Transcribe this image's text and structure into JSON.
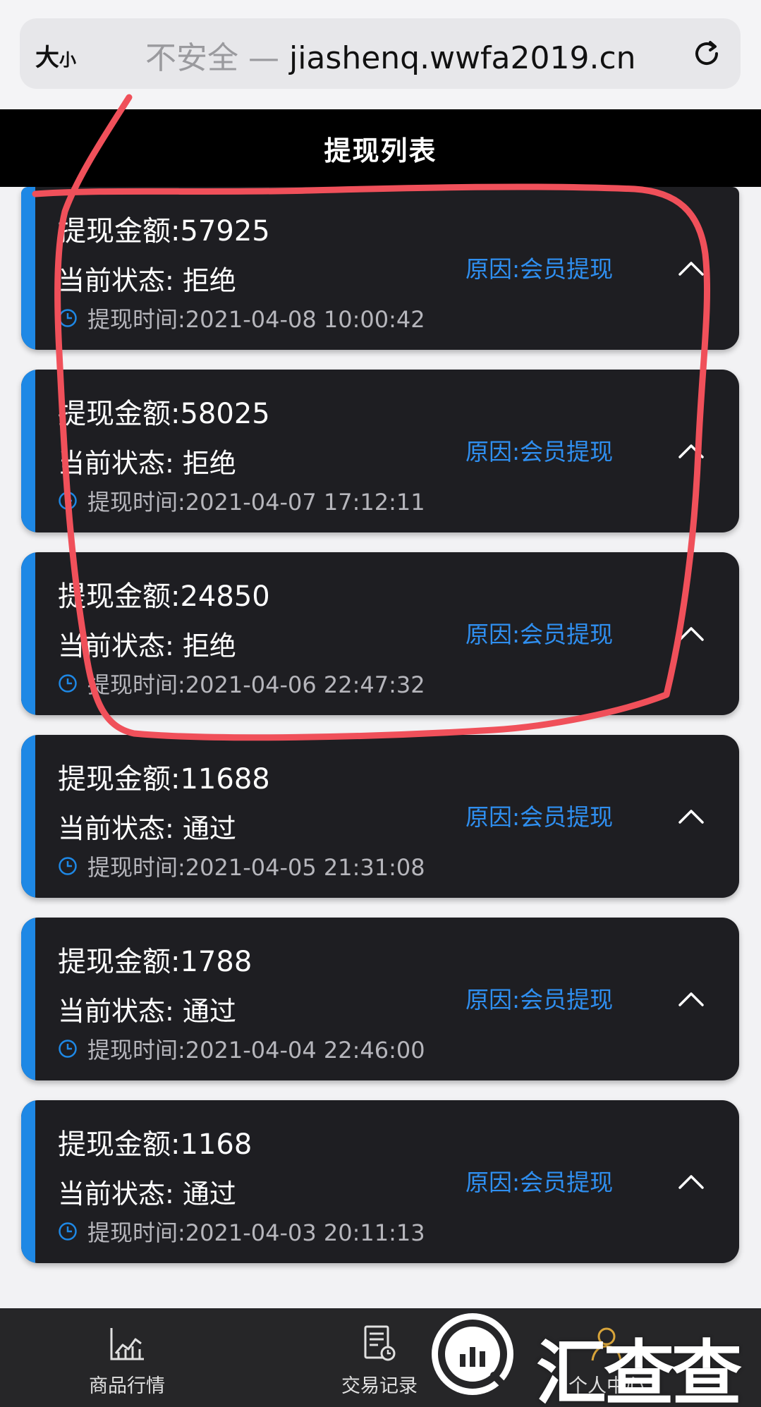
{
  "browser": {
    "text_size_big": "大",
    "text_size_small": "小",
    "insecure_label": "不安全 — ",
    "host": "jiashenq.wwfa2019.cn"
  },
  "header": {
    "title": "提现列表"
  },
  "withdrawals": [
    {
      "amount": "提现金额:57925",
      "status": "当前状态: 拒绝",
      "time": "提现时间:2021-04-08 10:00:42",
      "reason": "原因:会员提现"
    },
    {
      "amount": "提现金额:58025",
      "status": "当前状态: 拒绝",
      "time": "提现时间:2021-04-07 17:12:11",
      "reason": "原因:会员提现"
    },
    {
      "amount": "提现金额:24850",
      "status": "当前状态: 拒绝",
      "time": "提现时间:2021-04-06 22:47:32",
      "reason": "原因:会员提现"
    },
    {
      "amount": "提现金额:11688",
      "status": "当前状态: 通过",
      "time": "提现时间:2021-04-05 21:31:08",
      "reason": "原因:会员提现"
    },
    {
      "amount": "提现金额:1788",
      "status": "当前状态: 通过",
      "time": "提现时间:2021-04-04 22:46:00",
      "reason": "原因:会员提现"
    },
    {
      "amount": "提现金额:1168",
      "status": "当前状态: 通过",
      "time": "提现时间:2021-04-03 20:11:13",
      "reason": "原因:会员提现"
    }
  ],
  "bottom_nav": {
    "market_label": "商品行情",
    "records_label": "交易记录",
    "account_label": "个人中心"
  },
  "watermark": {
    "text": "汇查查"
  },
  "colors": {
    "accent_blue": "#1e88e5",
    "reason_blue": "#2f8ff0",
    "card_bg": "#1e1e22",
    "annotation_red": "#f0505a"
  },
  "icons": [
    "reload-icon",
    "clock-icon",
    "chevron-up-icon",
    "chart-icon",
    "receipt-icon",
    "user-icon"
  ]
}
